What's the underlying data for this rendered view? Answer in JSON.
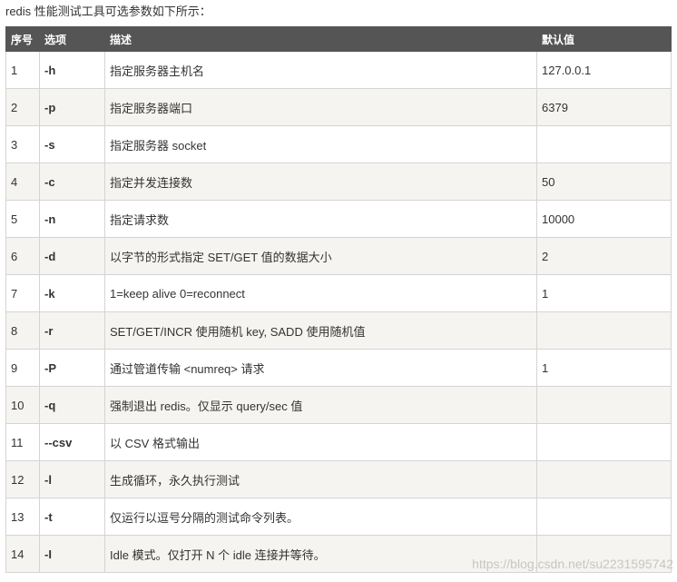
{
  "intro": "redis 性能测试工具可选参数如下所示：",
  "table": {
    "headers": [
      "序号",
      "选项",
      "描述",
      "默认值"
    ],
    "rows": [
      {
        "no": "1",
        "option": "-h",
        "desc": "指定服务器主机名",
        "default": "127.0.0.1"
      },
      {
        "no": "2",
        "option": "-p",
        "desc": "指定服务器端口",
        "default": "6379"
      },
      {
        "no": "3",
        "option": "-s",
        "desc": "指定服务器 socket",
        "default": ""
      },
      {
        "no": "4",
        "option": "-c",
        "desc": "指定并发连接数",
        "default": "50"
      },
      {
        "no": "5",
        "option": "-n",
        "desc": "指定请求数",
        "default": "10000"
      },
      {
        "no": "6",
        "option": "-d",
        "desc": "以字节的形式指定 SET/GET 值的数据大小",
        "default": "2"
      },
      {
        "no": "7",
        "option": "-k",
        "desc": "1=keep alive 0=reconnect",
        "default": "1"
      },
      {
        "no": "8",
        "option": "-r",
        "desc": "SET/GET/INCR 使用随机 key, SADD 使用随机值",
        "default": ""
      },
      {
        "no": "9",
        "option": "-P",
        "desc": "通过管道传输 <numreq> 请求",
        "default": "1"
      },
      {
        "no": "10",
        "option": "-q",
        "desc": "强制退出 redis。仅显示 query/sec 值",
        "default": ""
      },
      {
        "no": "11",
        "option": "--csv",
        "desc": "以 CSV 格式输出",
        "default": ""
      },
      {
        "no": "12",
        "option": "-l",
        "desc": "生成循环，永久执行测试",
        "default": ""
      },
      {
        "no": "13",
        "option": "-t",
        "desc": "仅运行以逗号分隔的测试命令列表。",
        "default": ""
      },
      {
        "no": "14",
        "option": "-I",
        "desc": "Idle 模式。仅打开 N 个 idle 连接并等待。",
        "default": ""
      }
    ]
  },
  "watermark": "https://blog.csdn.net/su2231595742"
}
